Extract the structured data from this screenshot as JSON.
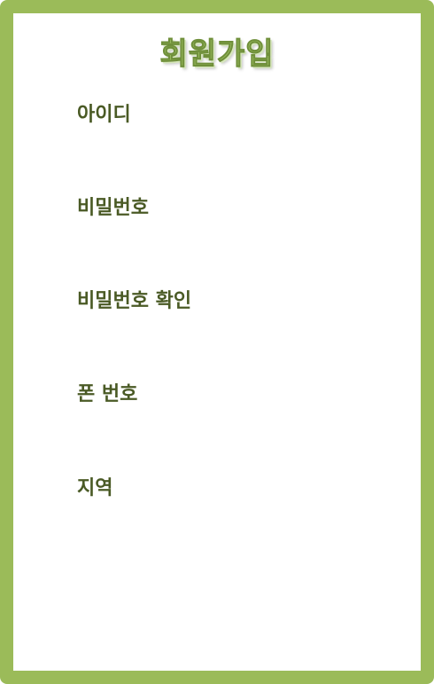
{
  "form": {
    "title": "회원가입",
    "fields": [
      {
        "label": "아이디"
      },
      {
        "label": "비밀번호"
      },
      {
        "label": "비밀번호 확인"
      },
      {
        "label": "폰 번호"
      },
      {
        "label": "지역"
      }
    ]
  },
  "colors": {
    "frame": "#9bbb59",
    "label_text": "#4a5a25",
    "title_fill": "#a6c86a"
  }
}
